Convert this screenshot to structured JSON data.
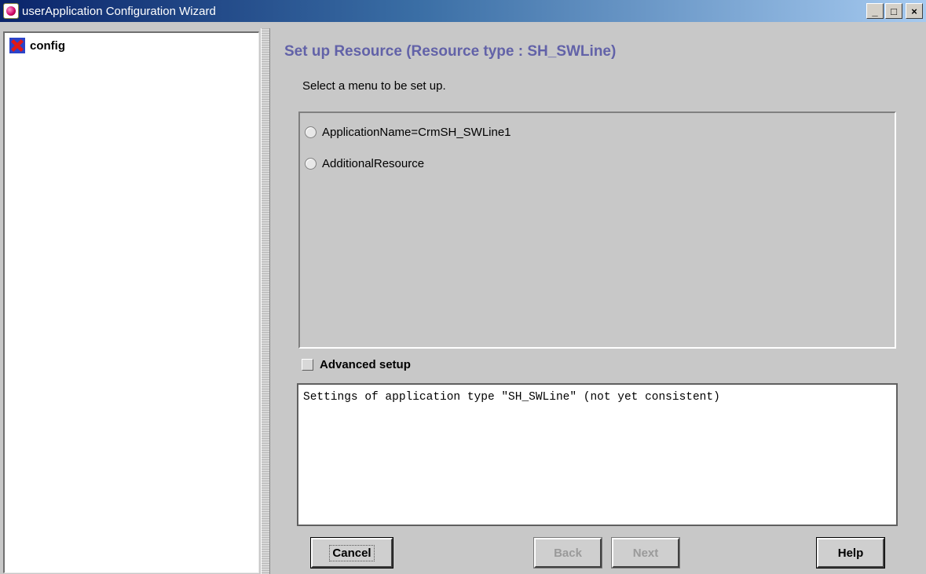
{
  "window": {
    "title": "userApplication Configuration Wizard",
    "minimize": "_",
    "maximize": "□",
    "close": "×"
  },
  "tree": {
    "root_label": "config"
  },
  "panel": {
    "heading": "Set up Resource (Resource type : SH_SWLine)",
    "instruction": "Select a menu to be set up.",
    "menu_items": [
      {
        "label": "ApplicationName=CrmSH_SWLine1",
        "selected": false
      },
      {
        "label": "AdditionalResource",
        "selected": false
      }
    ],
    "advanced_setup_label": "Advanced setup",
    "advanced_setup_checked": false,
    "status_text": "Settings of application type \"SH_SWLine\" (not yet consistent)"
  },
  "buttons": {
    "cancel": "Cancel",
    "back": "Back",
    "next": "Next",
    "help": "Help"
  },
  "colors": {
    "heading": "#6262a8",
    "titlebar_start": "#0a246a",
    "titlebar_end": "#a6caf0"
  }
}
